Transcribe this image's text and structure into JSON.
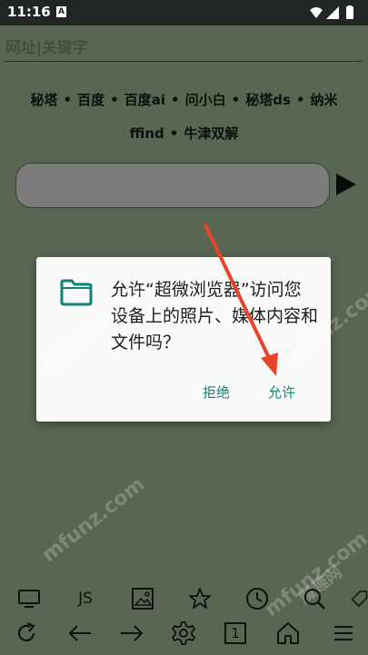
{
  "status_bar": {
    "time": "11:16",
    "notification_icon": "A"
  },
  "url_bar": {
    "placeholder": "网址|关键字"
  },
  "quick_links": {
    "row1": [
      "秘塔",
      "百度",
      "百度ai",
      "问小白",
      "秘塔ds",
      "纳米"
    ],
    "row2": [
      "ffind",
      "牛津双解"
    ],
    "separator": "•"
  },
  "dialog": {
    "icon": "folder-icon",
    "message": "允许“超微浏览器”访问您设备上的照片、媒体内容和文件吗？",
    "deny_label": "拒绝",
    "allow_label": "允许",
    "accent_color": "#0f8375"
  },
  "toolbar_top": {
    "items": [
      "desktop-icon",
      "JS",
      "image-icon",
      "star-icon",
      "clock-icon",
      "search-icon",
      "tag-icon"
    ],
    "js_label": "JS"
  },
  "toolbar_bottom": {
    "items": [
      "refresh-icon",
      "back-arrow-icon",
      "forward-arrow-icon",
      "settings-icon",
      "tabs-count",
      "home-icon",
      "menu-icon"
    ],
    "tab_count": "1"
  },
  "watermarks": [
    "mfunz.com",
    "mfunz.com",
    "mfunz.com",
    "mfunz.com",
    "魔趣网"
  ],
  "colors": {
    "background": "#56614f",
    "statusbar": "#222622",
    "dialog_bg": "#fafafa",
    "annotation_arrow": "#e8442a"
  }
}
